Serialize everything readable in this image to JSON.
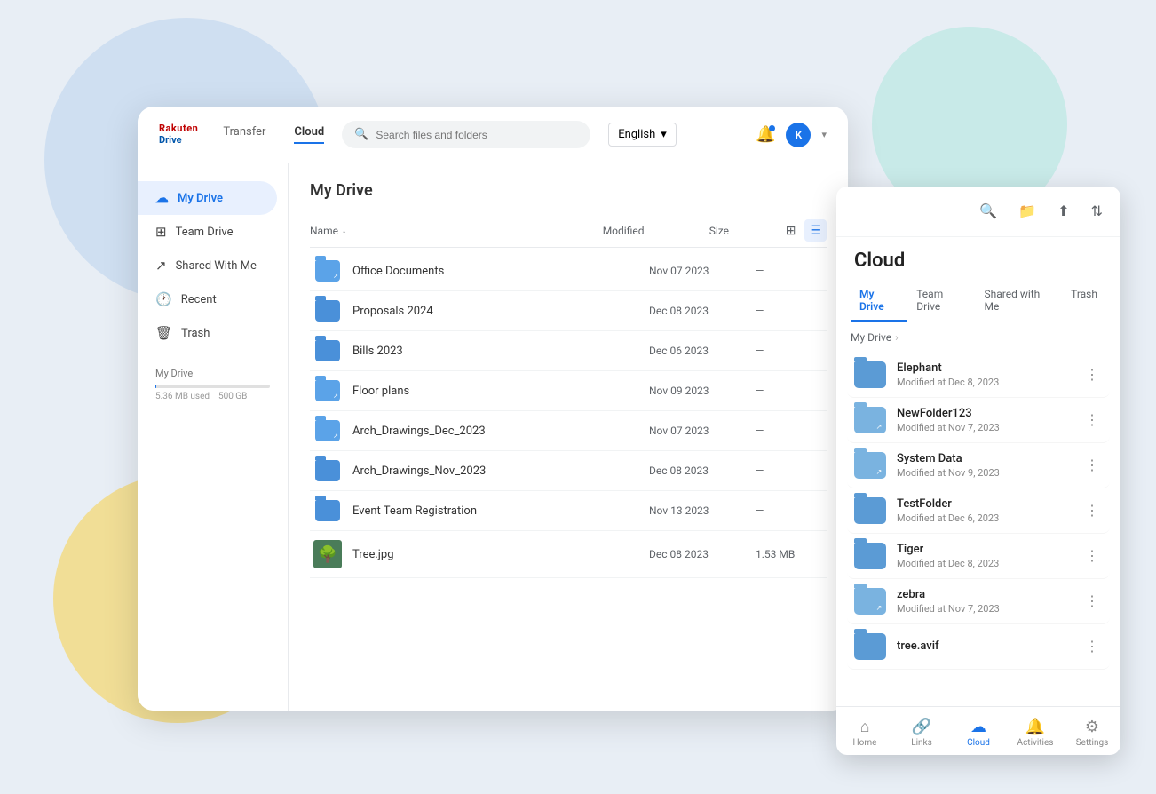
{
  "background": {
    "circles": [
      {
        "class": "bg-circle-blue"
      },
      {
        "class": "bg-circle-teal"
      },
      {
        "class": "bg-circle-yellow"
      },
      {
        "class": "bg-circle-green"
      }
    ]
  },
  "topNav": {
    "logo": {
      "rakuten": "Rakuten",
      "drive": "Drive"
    },
    "tabs": [
      {
        "label": "Transfer",
        "active": false
      },
      {
        "label": "Cloud",
        "active": true
      }
    ],
    "search": {
      "placeholder": "Search files and folders"
    },
    "language": {
      "label": "English",
      "arrow": "▾"
    },
    "bell": "🔔",
    "user_initial": "K"
  },
  "sidebar": {
    "items": [
      {
        "label": "My Drive",
        "icon": "☁",
        "active": true
      },
      {
        "label": "Team Drive",
        "icon": "⊞",
        "active": false
      },
      {
        "label": "Shared With Me",
        "icon": "↗",
        "active": false
      },
      {
        "label": "Recent",
        "icon": "🕐",
        "active": false
      },
      {
        "label": "Trash",
        "icon": "🗑",
        "active": false
      }
    ],
    "storage": {
      "label": "My Drive",
      "used": "5.36 MB used",
      "total": "500 GB",
      "percent": 0.2
    }
  },
  "fileList": {
    "title": "My Drive",
    "columns": {
      "name": "Name",
      "modified": "Modified",
      "size": "Size"
    },
    "files": [
      {
        "name": "Office Documents",
        "modified": "Nov 07 2023",
        "size": "—",
        "type": "folder-shared"
      },
      {
        "name": "Proposals 2024",
        "modified": "Dec 08 2023",
        "size": "—",
        "type": "folder"
      },
      {
        "name": "Bills 2023",
        "modified": "Dec 06 2023",
        "size": "—",
        "type": "folder"
      },
      {
        "name": "Floor plans",
        "modified": "Nov 09 2023",
        "size": "—",
        "type": "folder-shared"
      },
      {
        "name": "Arch_Drawings_Dec_2023",
        "modified": "Nov 07 2023",
        "size": "—",
        "type": "folder-shared"
      },
      {
        "name": "Arch_Drawings_Nov_2023",
        "modified": "Dec 08 2023",
        "size": "—",
        "type": "folder"
      },
      {
        "name": "Event Team Registration",
        "modified": "Nov 13 2023",
        "size": "—",
        "type": "folder"
      },
      {
        "name": "Tree.jpg",
        "modified": "Dec 08 2023",
        "size": "1.53 MB",
        "type": "image"
      }
    ]
  },
  "rightPanel": {
    "title": "Cloud",
    "tabs": [
      "My Drive",
      "Team Drive",
      "Shared with Me",
      "Trash"
    ],
    "activeTab": "My Drive",
    "breadcrumb": [
      "My Drive"
    ],
    "files": [
      {
        "name": "Elephant",
        "date": "Modified at Dec 8, 2023",
        "type": "folder"
      },
      {
        "name": "NewFolder123",
        "date": "Modified at Nov 7, 2023",
        "type": "folder-shared"
      },
      {
        "name": "System Data",
        "date": "Modified at Nov 9, 2023",
        "type": "folder-shared"
      },
      {
        "name": "TestFolder",
        "date": "Modified at Dec 6, 2023",
        "type": "folder"
      },
      {
        "name": "Tiger",
        "date": "Modified at Dec 8, 2023",
        "type": "folder"
      },
      {
        "name": "zebra",
        "date": "Modified at Nov 7, 2023",
        "type": "folder-shared"
      },
      {
        "name": "tree.avif",
        "date": "",
        "type": "folder"
      }
    ],
    "bottomNav": [
      {
        "label": "Home",
        "icon": "⌂",
        "active": false
      },
      {
        "label": "Links",
        "icon": "🔗",
        "active": false
      },
      {
        "label": "Cloud",
        "icon": "☁",
        "active": true
      },
      {
        "label": "Activities",
        "icon": "🔔",
        "active": false
      },
      {
        "label": "Settings",
        "icon": "⚙",
        "active": false
      }
    ]
  }
}
